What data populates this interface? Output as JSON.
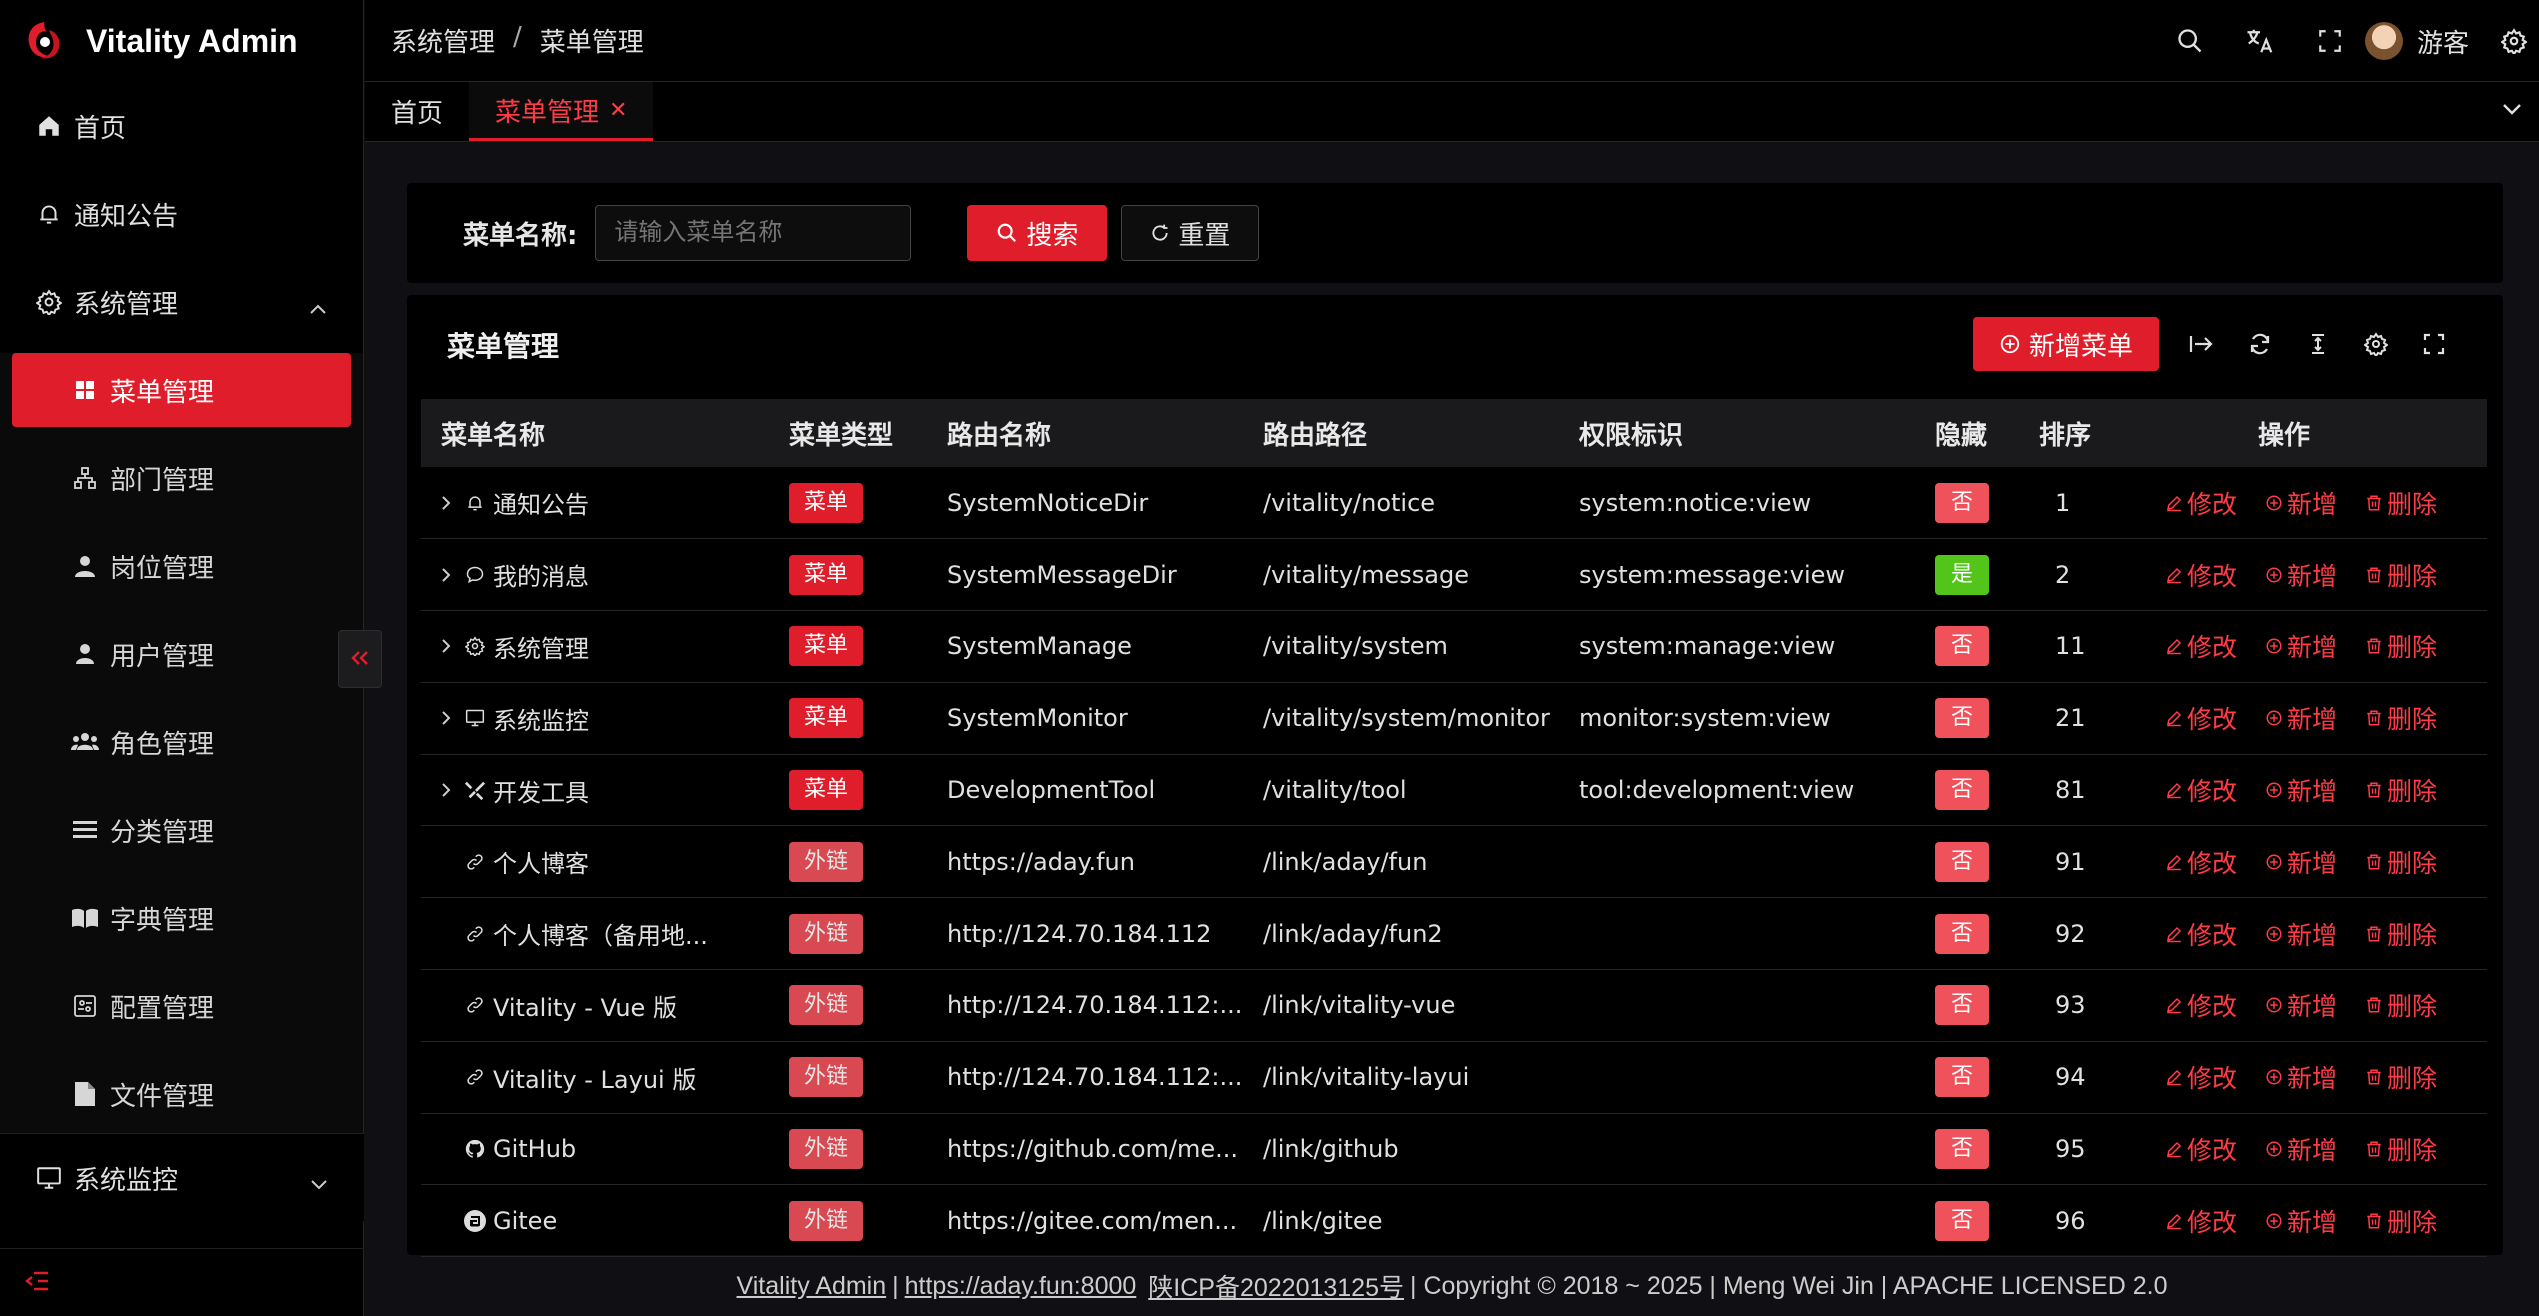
{
  "app": {
    "title": "Vitality Admin"
  },
  "sidebar": {
    "home": "首页",
    "notice": "通知公告",
    "system_group": "系统管理",
    "system_items": [
      {
        "label": "菜单管理",
        "icon": "grid-icon",
        "active": true
      },
      {
        "label": "部门管理",
        "icon": "org-tree-icon"
      },
      {
        "label": "岗位管理",
        "icon": "user-tie-icon"
      },
      {
        "label": "用户管理",
        "icon": "user-icon"
      },
      {
        "label": "角色管理",
        "icon": "users-icon"
      },
      {
        "label": "分类管理",
        "icon": "list-icon"
      },
      {
        "label": "字典管理",
        "icon": "book-icon"
      },
      {
        "label": "配置管理",
        "icon": "config-icon"
      },
      {
        "label": "文件管理",
        "icon": "file-icon"
      }
    ],
    "monitor_group": "系统监控"
  },
  "header": {
    "breadcrumb": [
      "系统管理",
      "菜单管理"
    ],
    "breadcrumb_sep": "/",
    "username": "游客"
  },
  "tabs": [
    {
      "label": "首页",
      "active": false
    },
    {
      "label": "菜单管理",
      "active": true
    }
  ],
  "search": {
    "label": "菜单名称:",
    "placeholder": "请输入菜单名称",
    "search_button": "搜索",
    "reset_button": "重置"
  },
  "table": {
    "title": "菜单管理",
    "add_button": "新增菜单",
    "columns": [
      "菜单名称",
      "菜单类型",
      "路由名称",
      "路由路径",
      "权限标识",
      "隐藏",
      "排序",
      "操作"
    ],
    "actions": {
      "edit": "修改",
      "add": "新增",
      "delete": "删除"
    },
    "rows": [
      {
        "expand": true,
        "icon": "bell-icon",
        "name": "通知公告",
        "type": "菜单",
        "route_name": "SystemNoticeDir",
        "route_path": "/vitality/notice",
        "perm": "system:notice:view",
        "hidden": "否",
        "sort": "1"
      },
      {
        "expand": true,
        "icon": "chat-icon",
        "name": "我的消息",
        "type": "菜单",
        "route_name": "SystemMessageDir",
        "route_path": "/vitality/message",
        "perm": "system:message:view",
        "hidden": "是",
        "sort": "2"
      },
      {
        "expand": true,
        "icon": "gear-icon",
        "name": "系统管理",
        "type": "菜单",
        "route_name": "SystemManage",
        "route_path": "/vitality/system",
        "perm": "system:manage:view",
        "hidden": "否",
        "sort": "11"
      },
      {
        "expand": true,
        "icon": "monitor-icon",
        "name": "系统监控",
        "type": "菜单",
        "route_name": "SystemMonitor",
        "route_path": "/vitality/system/monitor",
        "perm": "monitor:system:view",
        "hidden": "否",
        "sort": "21"
      },
      {
        "expand": true,
        "icon": "tools-icon",
        "name": "开发工具",
        "type": "菜单",
        "route_name": "DevelopmentTool",
        "route_path": "/vitality/tool",
        "perm": "tool:development:view",
        "hidden": "否",
        "sort": "81"
      },
      {
        "expand": false,
        "icon": "link-icon",
        "name": "个人博客",
        "type": "外链",
        "route_name": "https://aday.fun",
        "route_path": "/link/aday/fun",
        "perm": "",
        "hidden": "否",
        "sort": "91"
      },
      {
        "expand": false,
        "icon": "link-icon",
        "name": "个人博客（备用地...",
        "type": "外链",
        "route_name": "http://124.70.184.112",
        "route_path": "/link/aday/fun2",
        "perm": "",
        "hidden": "否",
        "sort": "92"
      },
      {
        "expand": false,
        "icon": "link-icon",
        "name": "Vitality - Vue 版",
        "type": "外链",
        "route_name": "http://124.70.184.112:...",
        "route_path": "/link/vitality-vue",
        "perm": "",
        "hidden": "否",
        "sort": "93"
      },
      {
        "expand": false,
        "icon": "link-icon",
        "name": "Vitality - Layui 版",
        "type": "外链",
        "route_name": "http://124.70.184.112:...",
        "route_path": "/link/vitality-layui",
        "perm": "",
        "hidden": "否",
        "sort": "94"
      },
      {
        "expand": false,
        "icon": "github-icon",
        "name": "GitHub",
        "type": "外链",
        "route_name": "https://github.com/me...",
        "route_path": "/link/github",
        "perm": "",
        "hidden": "否",
        "sort": "95"
      },
      {
        "expand": false,
        "icon": "gitee-icon",
        "name": "Gitee",
        "type": "外链",
        "route_name": "https://gitee.com/men...",
        "route_path": "/link/gitee",
        "perm": "",
        "hidden": "否",
        "sort": "96"
      }
    ]
  },
  "footer": {
    "app_link": "Vitality Admin",
    "sep1": "|",
    "site_link": "https://aday.fun:8000",
    "icp": "陕ICP备2022013125号",
    "rest": "| Copyright © 2018 ~ 2025 | Meng Wei Jin | APACHE LICENSED 2.0"
  },
  "colors": {
    "accent": "#e01d2a",
    "success": "#52c41a",
    "background": "#000000"
  }
}
